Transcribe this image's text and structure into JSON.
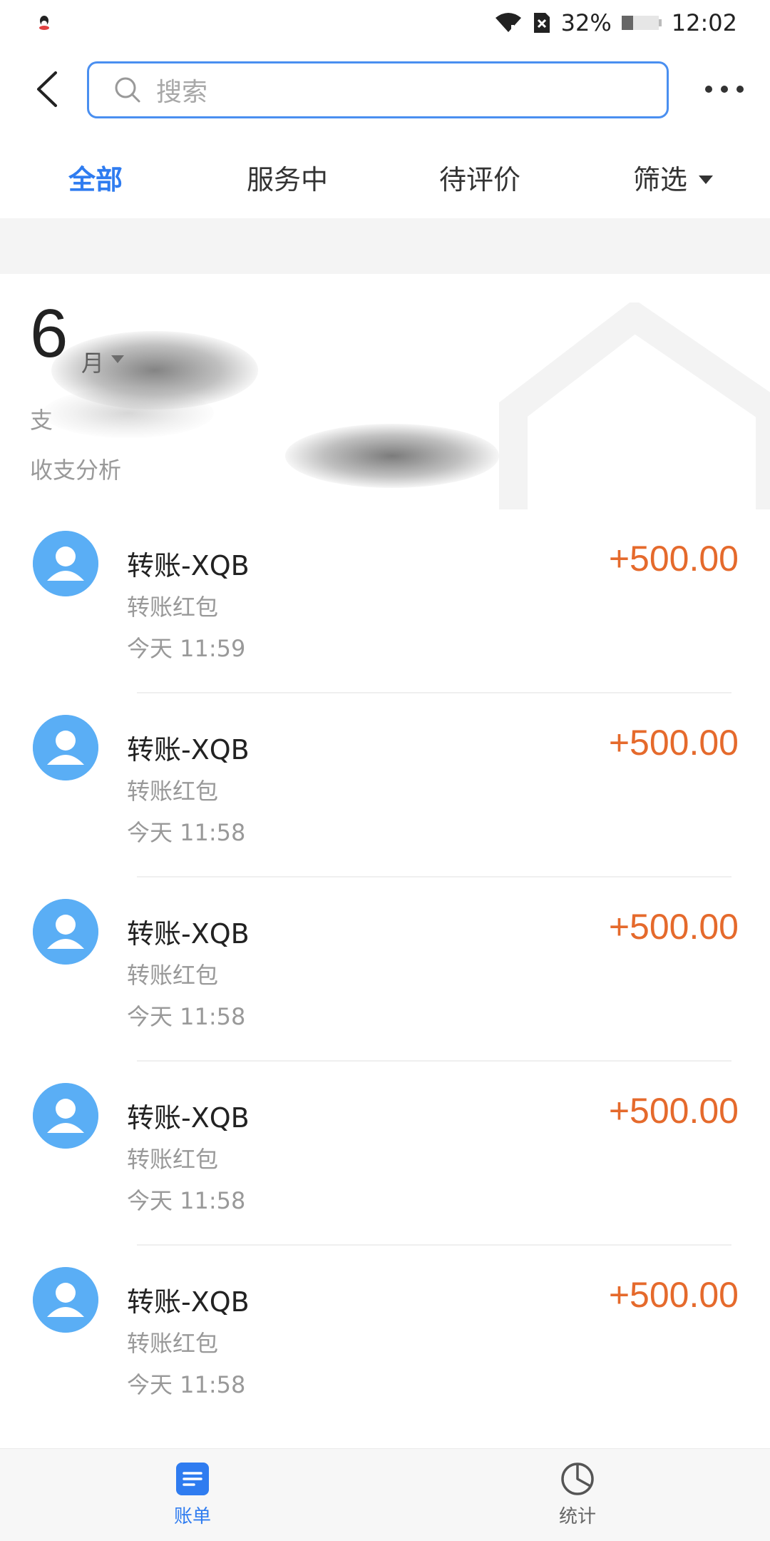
{
  "status_bar": {
    "battery_percent": "32%",
    "battery_level": 0.32,
    "time": "12:02",
    "icons": [
      "qq-icon",
      "wifi-icon",
      "no-sim-icon",
      "battery-icon"
    ]
  },
  "header": {
    "search_placeholder": "搜索",
    "icons": [
      "back-icon",
      "search-icon",
      "more-icon"
    ]
  },
  "tabs": [
    {
      "label": "全部",
      "active": true
    },
    {
      "label": "服务中",
      "active": false
    },
    {
      "label": "待评价",
      "active": false
    },
    {
      "label": "筛选",
      "active": false
    }
  ],
  "month": {
    "number": "6",
    "unit": "月",
    "summary_visible": "支",
    "analysis_visible": "收支分析"
  },
  "transactions": [
    {
      "title": "转账-XQB",
      "subtitle": "转账红包",
      "time": "今天  11:59",
      "amount": "+500.00"
    },
    {
      "title": "转账-XQB",
      "subtitle": "转账红包",
      "time": "今天  11:58",
      "amount": "+500.00"
    },
    {
      "title": "转账-XQB",
      "subtitle": "转账红包",
      "time": "今天  11:58",
      "amount": "+500.00"
    },
    {
      "title": "转账-XQB",
      "subtitle": "转账红包",
      "time": "今天  11:58",
      "amount": "+500.00"
    },
    {
      "title": "转账-XQB",
      "subtitle": "转账红包",
      "time": "今天  11:58",
      "amount": "+500.00"
    }
  ],
  "bottom_nav": [
    {
      "label": "账单",
      "icon": "bill-icon",
      "active": true
    },
    {
      "label": "统计",
      "icon": "stats-icon",
      "active": false
    }
  ],
  "colors": {
    "accent": "#2f7cf0",
    "amount": "#e56a2c",
    "avatar": "#5aaef5",
    "search_border": "#4a8ff0"
  }
}
